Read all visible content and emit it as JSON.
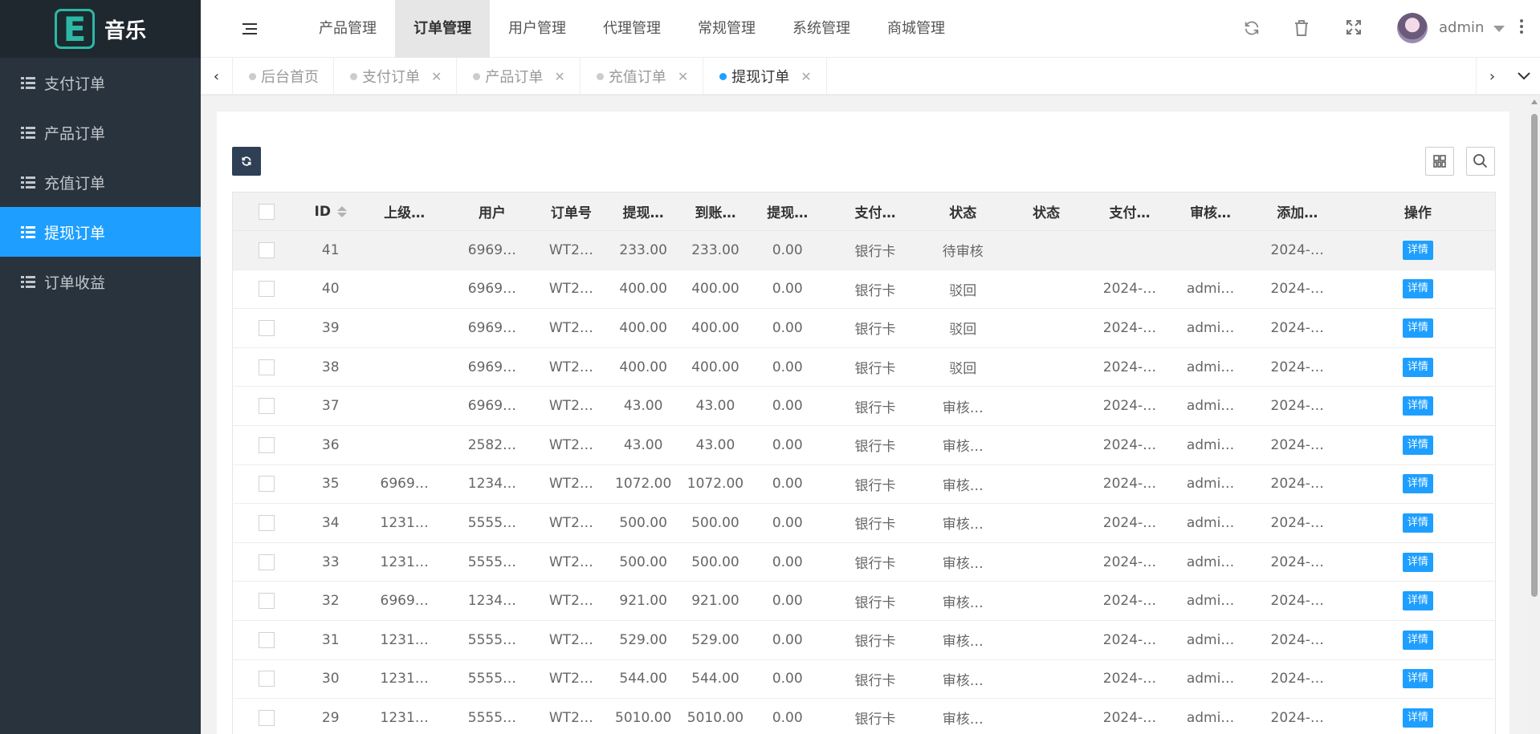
{
  "logo": {
    "letter": "E",
    "title": "音乐"
  },
  "sidebar": {
    "items": [
      {
        "label": "支付订单",
        "active": false
      },
      {
        "label": "产品订单",
        "active": false
      },
      {
        "label": "充值订单",
        "active": false
      },
      {
        "label": "提现订单",
        "active": true
      },
      {
        "label": "订单收益",
        "active": false
      }
    ]
  },
  "topnav": {
    "items": [
      {
        "label": "产品管理",
        "active": false
      },
      {
        "label": "订单管理",
        "active": true
      },
      {
        "label": "用户管理",
        "active": false
      },
      {
        "label": "代理管理",
        "active": false
      },
      {
        "label": "常规管理",
        "active": false
      },
      {
        "label": "系统管理",
        "active": false
      },
      {
        "label": "商城管理",
        "active": false
      }
    ]
  },
  "header": {
    "username": "admin"
  },
  "tabs": [
    {
      "label": "后台首页",
      "closable": false,
      "active": false
    },
    {
      "label": "支付订单",
      "closable": true,
      "active": false
    },
    {
      "label": "产品订单",
      "closable": true,
      "active": false
    },
    {
      "label": "充值订单",
      "closable": true,
      "active": false
    },
    {
      "label": "提现订单",
      "closable": true,
      "active": true
    }
  ],
  "table": {
    "columns": [
      "ID",
      "上级…",
      "用户",
      "订单号",
      "提现…",
      "到账…",
      "提现…",
      "支付…",
      "状态",
      "状态",
      "支付…",
      "审核…",
      "添加…",
      "操作"
    ],
    "action_label": "详情",
    "rows": [
      [
        "41",
        "",
        "6969…",
        "WT2…",
        "233.00",
        "233.00",
        "0.00",
        "银行卡",
        "待审核",
        "",
        "",
        "",
        "2024-…"
      ],
      [
        "40",
        "",
        "6969…",
        "WT2…",
        "400.00",
        "400.00",
        "0.00",
        "银行卡",
        "驳回",
        "",
        "2024-…",
        "admi…",
        "2024-…"
      ],
      [
        "39",
        "",
        "6969…",
        "WT2…",
        "400.00",
        "400.00",
        "0.00",
        "银行卡",
        "驳回",
        "",
        "2024-…",
        "admi…",
        "2024-…"
      ],
      [
        "38",
        "",
        "6969…",
        "WT2…",
        "400.00",
        "400.00",
        "0.00",
        "银行卡",
        "驳回",
        "",
        "2024-…",
        "admi…",
        "2024-…"
      ],
      [
        "37",
        "",
        "6969…",
        "WT2…",
        "43.00",
        "43.00",
        "0.00",
        "银行卡",
        "审核…",
        "",
        "2024-…",
        "admi…",
        "2024-…"
      ],
      [
        "36",
        "",
        "2582…",
        "WT2…",
        "43.00",
        "43.00",
        "0.00",
        "银行卡",
        "审核…",
        "",
        "2024-…",
        "admi…",
        "2024-…"
      ],
      [
        "35",
        "6969…",
        "1234…",
        "WT2…",
        "1072.00",
        "1072.00",
        "0.00",
        "银行卡",
        "审核…",
        "",
        "2024-…",
        "admi…",
        "2024-…"
      ],
      [
        "34",
        "1231…",
        "5555…",
        "WT2…",
        "500.00",
        "500.00",
        "0.00",
        "银行卡",
        "审核…",
        "",
        "2024-…",
        "admi…",
        "2024-…"
      ],
      [
        "33",
        "1231…",
        "5555…",
        "WT2…",
        "500.00",
        "500.00",
        "0.00",
        "银行卡",
        "审核…",
        "",
        "2024-…",
        "admi…",
        "2024-…"
      ],
      [
        "32",
        "6969…",
        "1234…",
        "WT2…",
        "921.00",
        "921.00",
        "0.00",
        "银行卡",
        "审核…",
        "",
        "2024-…",
        "admi…",
        "2024-…"
      ],
      [
        "31",
        "1231…",
        "5555…",
        "WT2…",
        "529.00",
        "529.00",
        "0.00",
        "银行卡",
        "审核…",
        "",
        "2024-…",
        "admi…",
        "2024-…"
      ],
      [
        "30",
        "1231…",
        "5555…",
        "WT2…",
        "544.00",
        "544.00",
        "0.00",
        "银行卡",
        "审核…",
        "",
        "2024-…",
        "admi…",
        "2024-…"
      ],
      [
        "29",
        "1231…",
        "5555…",
        "WT2…",
        "5010.00",
        "5010.00",
        "0.00",
        "银行卡",
        "审核…",
        "",
        "2024-…",
        "admi…",
        "2024-…"
      ]
    ]
  }
}
